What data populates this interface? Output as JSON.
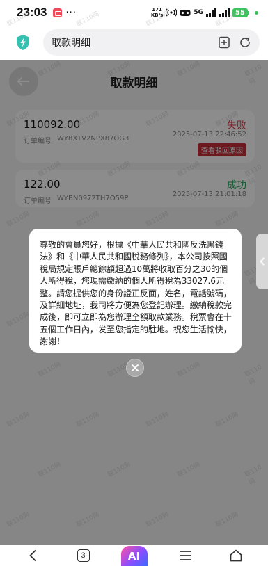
{
  "status_bar": {
    "time": "23:03",
    "dots": "···",
    "speed_value": "171",
    "speed_unit": "KB/s",
    "network_label": "5G",
    "battery": "55"
  },
  "browser": {
    "url_title": "取款明细"
  },
  "page": {
    "title": "取款明细",
    "records": [
      {
        "amount": "110092.00",
        "status": "失败",
        "status_color": "#d8343e",
        "order_label": "订单编号",
        "order_no": "WY8XTV2NPX87OG3",
        "time": "2025-07-13 22:46:52",
        "action": "查看驳回原因"
      },
      {
        "amount": "122.00",
        "status": "成功",
        "status_color": "#23a559",
        "order_label": "订单编号",
        "order_no": "WYBN0972TH7O59P",
        "time": "2025-07-13 21:01:18"
      }
    ]
  },
  "dialog": {
    "message": "尊敬的會員您好，根據《中華人民共和國反洗黑錢法》和《中華人民共和國稅務條列》，本公司按照國稅局規定賬戶總餘額超過10萬將收取百分之30的個人所得稅，您現需繳納的個人所得稅為33027.6元整。請您提供您的身份證正反面，姓名，電話號碼，及詳細地址，我司將方便為您登記辦理。繳納稅款完成後，即可立即為您辦理全額取款業務。稅票會在十五個工作日內，发至您指定的駐地。祝您生活愉快，謝謝！"
  },
  "bottom_nav": {
    "tabs_count": "3",
    "ai_label": "AI"
  },
  "watermark": "联110网"
}
